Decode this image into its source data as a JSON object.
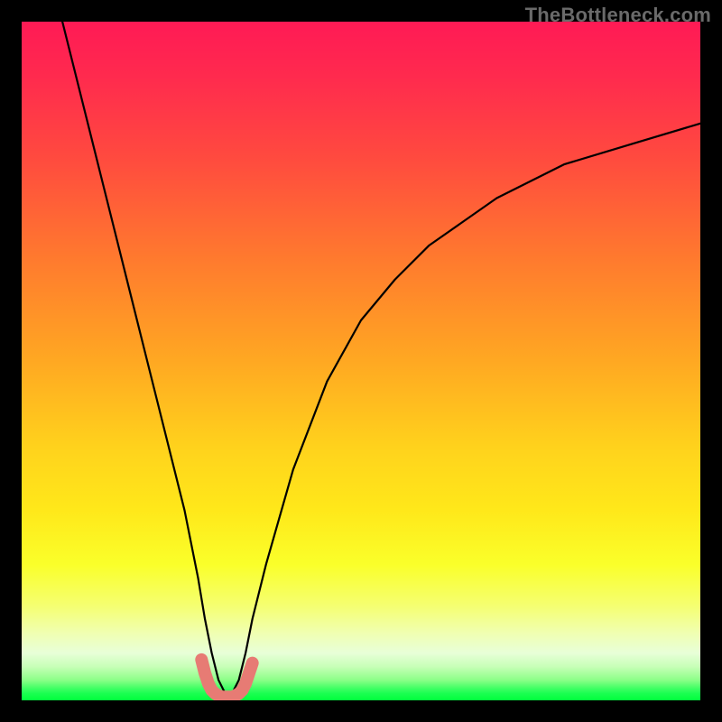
{
  "watermark": "TheBottleneck.com",
  "chart_data": {
    "type": "line",
    "title": "",
    "xlabel": "",
    "ylabel": "",
    "xlim": [
      0,
      100
    ],
    "ylim": [
      0,
      100
    ],
    "legend": false,
    "grid": false,
    "background": "vertical-gradient red→yellow→green",
    "notes": "V-shaped bottleneck curve; minimum (optimal point) around x≈30 at y≈0; short salmon marker segment sits at the valley floor.",
    "series": [
      {
        "name": "bottleneck-curve",
        "color": "#000000",
        "x": [
          6,
          8,
          10,
          12,
          14,
          16,
          18,
          20,
          22,
          24,
          26,
          27,
          28,
          29,
          30,
          31,
          32,
          33,
          34,
          36,
          40,
          45,
          50,
          55,
          60,
          70,
          80,
          90,
          100
        ],
        "y": [
          100,
          92,
          84,
          76,
          68,
          60,
          52,
          44,
          36,
          28,
          18,
          12,
          7,
          3,
          1,
          1,
          3,
          7,
          12,
          20,
          34,
          47,
          56,
          62,
          67,
          74,
          79,
          82,
          85
        ]
      },
      {
        "name": "optimal-marker",
        "color": "#e77b74",
        "x": [
          26.5,
          27.0,
          27.5,
          28.0,
          28.5,
          29.0,
          29.5,
          30.0,
          30.5,
          31.0,
          31.5,
          32.0,
          32.5,
          33.0,
          33.5,
          34.0
        ],
        "y": [
          6.0,
          4.0,
          2.5,
          1.5,
          1.0,
          0.7,
          0.5,
          0.5,
          0.5,
          0.5,
          0.7,
          1.0,
          1.5,
          2.5,
          4.0,
          5.5
        ]
      }
    ]
  }
}
